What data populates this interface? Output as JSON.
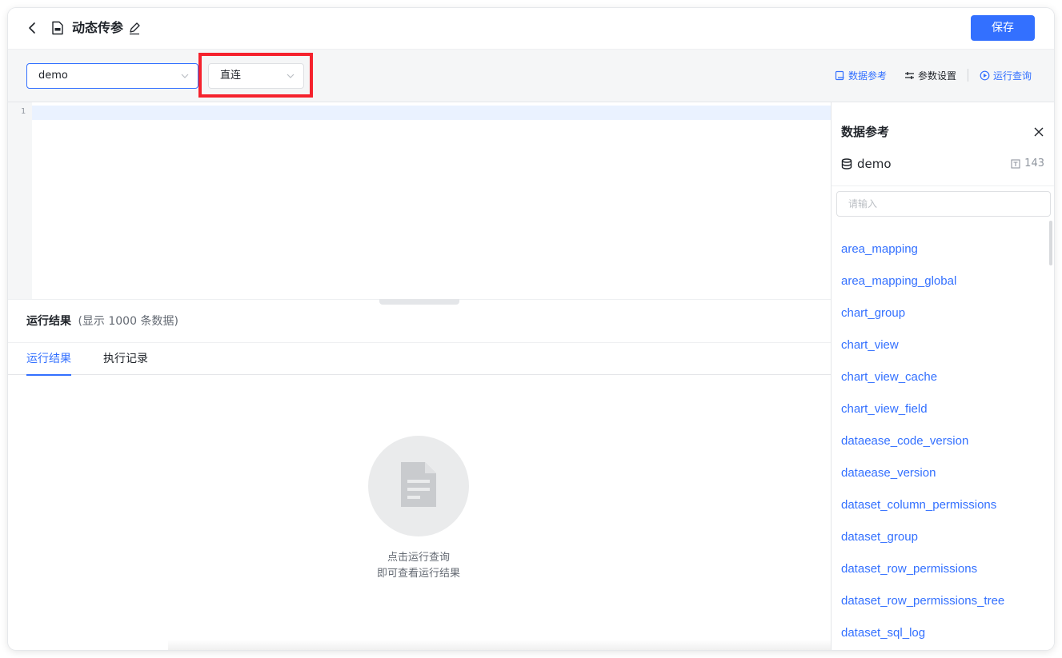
{
  "header": {
    "title": "动态传参",
    "save_label": "保存"
  },
  "toolbar": {
    "datasource_value": "demo",
    "mode_value": "直连",
    "data_reference_label": "数据参考",
    "param_settings_label": "参数设置",
    "run_query_label": "运行查询"
  },
  "editor": {
    "line_numbers": [
      "1"
    ]
  },
  "results": {
    "title": "运行结果",
    "count_text": "(显示 1000 条数据)",
    "tabs": [
      {
        "label": "运行结果"
      },
      {
        "label": "执行记录"
      }
    ],
    "empty_line1": "点击运行查询",
    "empty_line2": "即可查看运行结果"
  },
  "panel": {
    "title": "数据参考",
    "datasource_name": "demo",
    "table_count": "143",
    "search_placeholder": "请输入",
    "tables": [
      "area_mapping",
      "area_mapping_global",
      "chart_group",
      "chart_view",
      "chart_view_cache",
      "chart_view_field",
      "dataease_code_version",
      "dataease_version",
      "dataset_column_permissions",
      "dataset_group",
      "dataset_row_permissions",
      "dataset_row_permissions_tree",
      "dataset_sql_log"
    ]
  },
  "colors": {
    "accent": "#3370ff",
    "highlight": "#f5222d"
  }
}
